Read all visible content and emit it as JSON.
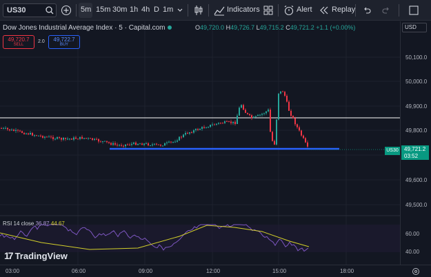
{
  "toolbar": {
    "symbol": "US30",
    "timeframes": [
      "5m",
      "15m",
      "30m",
      "1h",
      "4h",
      "D",
      "1m"
    ],
    "active_timeframe": "5m",
    "indicators_label": "Indicators",
    "alert_label": "Alert",
    "replay_label": "Replay"
  },
  "legend": {
    "title": "Dow Jones Industrial Average Index · 5 · Capital.com",
    "ohlc": [
      {
        "k": "O",
        "v": "49,720.0"
      },
      {
        "k": "H",
        "v": "49,726.7"
      },
      {
        "k": "L",
        "v": "49,715.2"
      },
      {
        "k": "C",
        "v": "49,721.2"
      }
    ],
    "change": "+1.1 (+0.00%)"
  },
  "trade": {
    "sell_price": "49,720.7",
    "sell_label": "SELL",
    "buy_price": "49,722.7",
    "buy_label": "BUY",
    "spread": "2.0"
  },
  "price_scale": {
    "currency": "USD",
    "labels": [
      "50,100.0",
      "50,000.0",
      "49,900.0",
      "49,800.0",
      "49,600.0",
      "49,500.0"
    ],
    "current_price": "49,721.2",
    "countdown": "03:52",
    "symbol_tag": "US30",
    "rsi_labels": [
      "60.00",
      "40.00"
    ]
  },
  "time_scale": {
    "labels": [
      "03:00",
      "06:00",
      "09:00",
      "12:00",
      "15:00",
      "18:00"
    ]
  },
  "rsi": {
    "label": "RSI 14 close",
    "value1": "36.87",
    "value2": "44.67"
  },
  "colors": {
    "up": "#26a69a",
    "down": "#f23645",
    "support_line": "#2962ff",
    "resistance_line": "#ffffff",
    "rsi_line": "#7e57c2",
    "rsi_ma": "#d4d02a"
  },
  "brand": "TradingView",
  "icons": [
    "search-icon",
    "plus-icon",
    "chevron-down-icon",
    "candles-icon",
    "indicators-icon",
    "templates-icon",
    "alert-icon",
    "replay-icon",
    "undo-icon",
    "redo-icon",
    "layout-icon",
    "settings-icon"
  ]
}
